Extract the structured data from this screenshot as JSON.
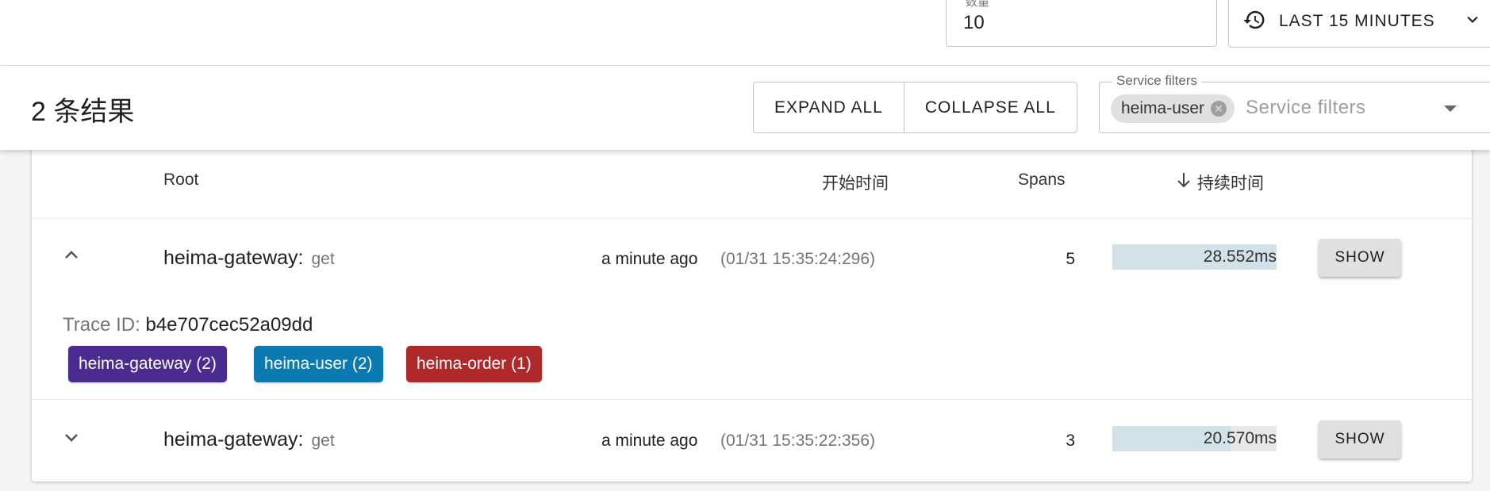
{
  "topbar": {
    "limit_label": "数量",
    "limit_value": "10",
    "time_range_label": "LAST 15 MINUTES",
    "time_range_icon": "history-icon"
  },
  "results": {
    "count_text": "2 条结果",
    "expand_all": "EXPAND ALL",
    "collapse_all": "COLLAPSE ALL",
    "service_filter_label": "Service filters",
    "service_filter_placeholder": "Service filters",
    "selected_services": [
      "heima-user"
    ]
  },
  "table": {
    "columns": {
      "root": "Root",
      "start_time": "开始时间",
      "spans": "Spans",
      "duration": "持续时间",
      "duration_sort": "arrow-down-icon"
    },
    "rows": [
      {
        "service": "heima-gateway:",
        "operation": "get",
        "time_relative": "a minute ago",
        "time_absolute": "(01/31 15:35:24:296)",
        "spans": "5",
        "duration": "28.552ms",
        "duration_fraction": 1.0,
        "show_label": "SHOW",
        "expanded": true,
        "trace_id_label": "Trace ID:",
        "trace_id": "b4e707cec52a09dd",
        "tags": [
          {
            "label": "heima-gateway (2)",
            "color": "#4b2b8f"
          },
          {
            "label": "heima-user (2)",
            "color": "#0a7ab0"
          },
          {
            "label": "heima-order (1)",
            "color": "#b0292a"
          }
        ]
      },
      {
        "service": "heima-gateway:",
        "operation": "get",
        "time_relative": "a minute ago",
        "time_absolute": "(01/31 15:35:22:356)",
        "spans": "3",
        "duration": "20.570ms",
        "duration_fraction": 0.72,
        "show_label": "SHOW",
        "expanded": false
      }
    ]
  }
}
